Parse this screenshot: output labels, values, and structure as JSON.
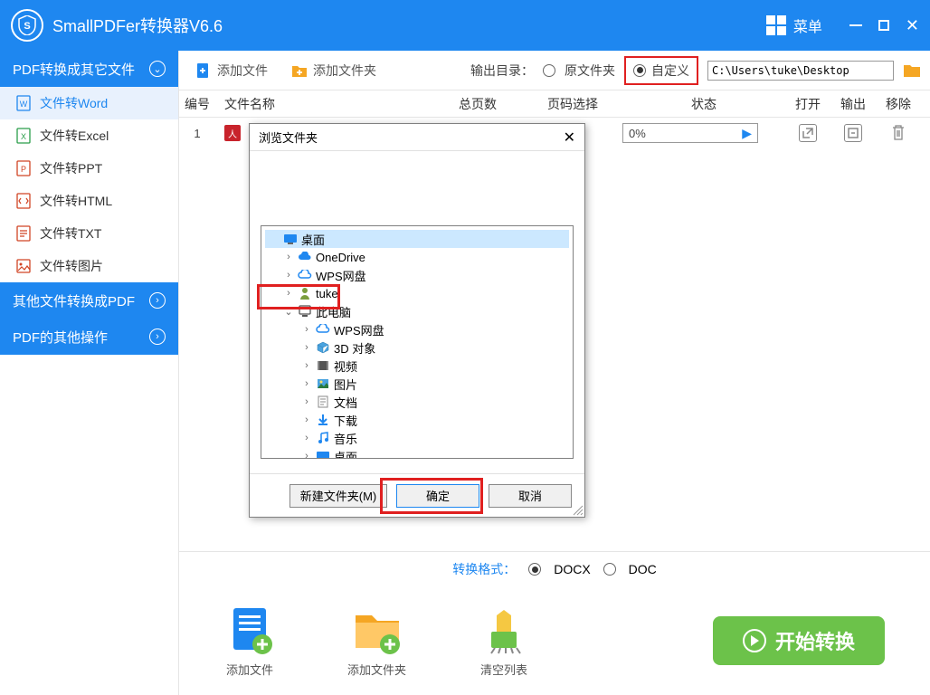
{
  "titlebar": {
    "app_title": "SmallPDFer转换器V6.6",
    "menu_label": "菜单"
  },
  "sidebar": {
    "header1": "PDF转换成其它文件",
    "items": [
      {
        "label": "文件转Word"
      },
      {
        "label": "文件转Excel"
      },
      {
        "label": "文件转PPT"
      },
      {
        "label": "文件转HTML"
      },
      {
        "label": "文件转TXT"
      },
      {
        "label": "文件转图片"
      }
    ],
    "header2": "其他文件转换成PDF",
    "header3": "PDF的其他操作"
  },
  "toolbar": {
    "add_file": "添加文件",
    "add_folder": "添加文件夹",
    "output_label": "输出目录：",
    "radio_orig": "原文件夹",
    "radio_custom": "自定义",
    "path": "C:\\Users\\tuke\\Desktop"
  },
  "grid": {
    "headers": {
      "num": "编号",
      "name": "文件名称",
      "pages": "总页数",
      "sel": "页码选择",
      "status": "状态",
      "open": "打开",
      "out": "输出",
      "del": "移除"
    },
    "rows": [
      {
        "num": "1",
        "progress": "0%"
      }
    ]
  },
  "footer": {
    "fmt_label": "转换格式：",
    "fmt_docx": "DOCX",
    "fmt_doc": "DOC",
    "add_file": "添加文件",
    "add_folder": "添加文件夹",
    "clear": "清空列表",
    "start": "开始转换"
  },
  "dialog": {
    "title": "浏览文件夹",
    "tree": [
      {
        "label": "桌面",
        "lvl": 0,
        "icon": "desktop",
        "sel": true
      },
      {
        "label": "OneDrive",
        "lvl": 1,
        "icon": "cloud",
        "exp": ">"
      },
      {
        "label": "WPS网盘",
        "lvl": 1,
        "icon": "cloud2",
        "exp": ">"
      },
      {
        "label": "tuke",
        "lvl": 1,
        "icon": "user",
        "exp": ">"
      },
      {
        "label": "此电脑",
        "lvl": 1,
        "icon": "pc",
        "exp": "v"
      },
      {
        "label": "WPS网盘",
        "lvl": 2,
        "icon": "cloud2",
        "exp": ">"
      },
      {
        "label": "3D 对象",
        "lvl": 2,
        "icon": "3d",
        "exp": ">"
      },
      {
        "label": "视频",
        "lvl": 2,
        "icon": "video",
        "exp": ">"
      },
      {
        "label": "图片",
        "lvl": 2,
        "icon": "image",
        "exp": ">"
      },
      {
        "label": "文档",
        "lvl": 2,
        "icon": "doc",
        "exp": ">"
      },
      {
        "label": "下载",
        "lvl": 2,
        "icon": "download",
        "exp": ">"
      },
      {
        "label": "音乐",
        "lvl": 2,
        "icon": "music",
        "exp": ">"
      },
      {
        "label": "桌面",
        "lvl": 2,
        "icon": "desktop",
        "exp": ">"
      }
    ],
    "new_folder": "新建文件夹(M)",
    "ok": "确定",
    "cancel": "取消"
  }
}
